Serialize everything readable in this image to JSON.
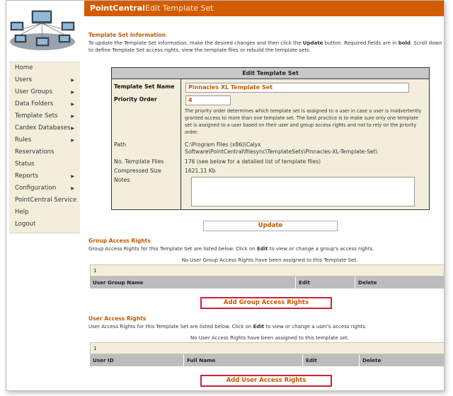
{
  "header": {
    "brand": "PointCentral",
    "title": "Edit Template Set"
  },
  "sidebar": {
    "items": [
      {
        "label": "Home",
        "arrow": ""
      },
      {
        "label": "Users",
        "arrow": "▶"
      },
      {
        "label": "User Groups",
        "arrow": "▶"
      },
      {
        "label": "Data Folders",
        "arrow": "▶"
      },
      {
        "label": "Template Sets",
        "arrow": "▶"
      },
      {
        "label": "Cardex Databases",
        "arrow": "▶"
      },
      {
        "label": "Rules",
        "arrow": "▶"
      },
      {
        "label": "Reservations",
        "arrow": ""
      },
      {
        "label": "Status",
        "arrow": ""
      },
      {
        "label": "Reports",
        "arrow": "▶"
      },
      {
        "label": "Configuration",
        "arrow": "▶"
      },
      {
        "label": "PointCentral Service",
        "arrow": ""
      },
      {
        "label": "Help",
        "arrow": ""
      },
      {
        "label": "Logout",
        "arrow": ""
      }
    ]
  },
  "info": {
    "title": "Template Set Information",
    "desc_part1": "To update the Template Set information, make the desired changes and then click the ",
    "desc_update": "Update",
    "desc_part2": " button. Required fields are in ",
    "desc_bold": "bold",
    "desc_part3": ". Scroll down to define Template Set access rights, view the template files or rebuild the template sets."
  },
  "edit": {
    "heading": "Edit Template Set",
    "name_label": "Template Set Name",
    "name_value": "Pinnacles XL Template Set",
    "priority_label": "Priority Order",
    "priority_value": "4",
    "priority_help": "The priority order determines which template set is assigned to a user in case a user is inadvertently granted access to more than one template set. The best practice is to make sure only one template set is assigned to a user based on their user and group access rights and not to rely on the priority order.",
    "path_label": "Path",
    "path_value_1": "C:\\Program Files (x86)\\Calyx",
    "path_value_2": "Software\\PointCentral\\filesync\\TemplateSets\\Pinnacles-XL-Template-Set\\",
    "files_label": "No. Template Files",
    "files_value": "176 (see below for a detailed list of template files)",
    "size_label": "Compressed Size",
    "size_value": "1621.11 Kb",
    "notes_label": "Notes",
    "notes_value": ""
  },
  "buttons": {
    "update": "Update",
    "add_group": "Add Group Access Rights",
    "add_user": "Add User Access Rights"
  },
  "group_rights": {
    "title": "Group Access Rights",
    "desc_part1": "Group Access Rights for this Template Set are listed below. Click on ",
    "desc_edit": "Edit",
    "desc_part2": " to view or change a group's access rights.",
    "note": "No User Group Access Rights have been assigned to this Template Set.",
    "count": "1",
    "columns": [
      "User Group Name",
      "Edit",
      "Delete"
    ]
  },
  "user_rights": {
    "title": "User Access Rights",
    "desc_part1": "User Access Rights for this Template Set are listed below. Click on ",
    "desc_edit": "Edit",
    "desc_part2": " to view or change a user's access rights.",
    "note": "No User Access Rights have been assigned to this template set.",
    "count": "1",
    "columns": [
      "User ID",
      "Full Name",
      "Edit",
      "Delete"
    ]
  },
  "colors": {
    "brand_orange": "#d35c00",
    "label_orange": "#c05a00",
    "panel_beige": "#f3eedc",
    "button_red_border": "#cc2233"
  }
}
